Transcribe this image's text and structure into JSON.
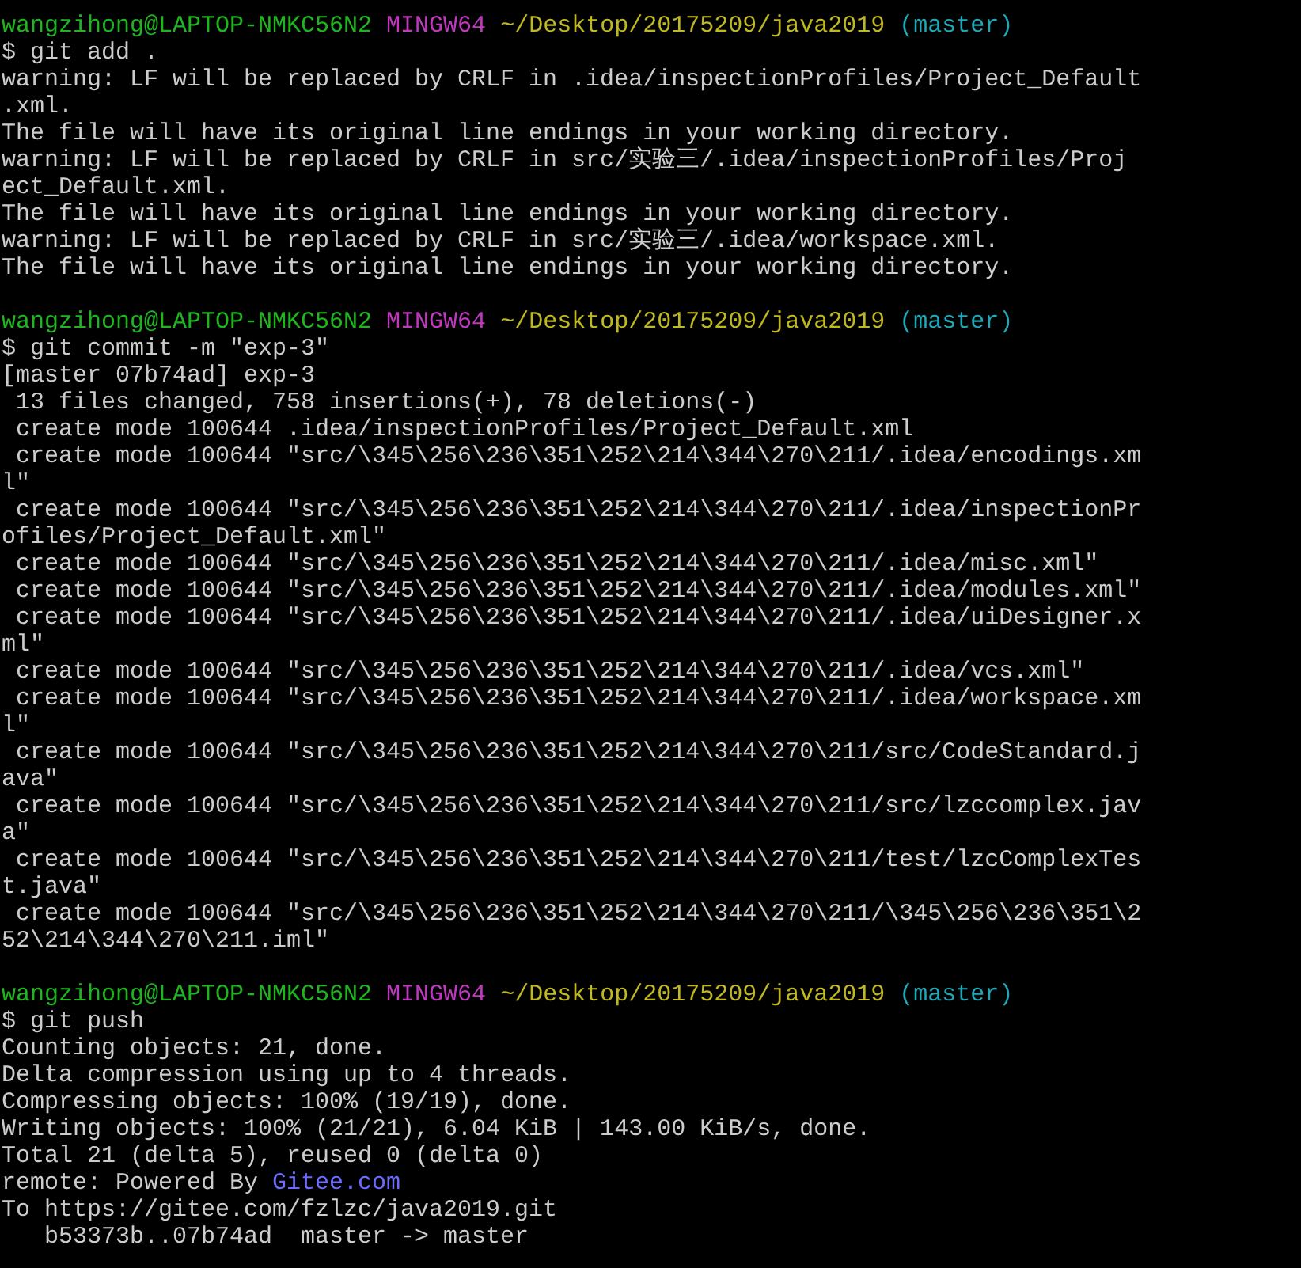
{
  "lines": [
    {
      "kind": "prompt",
      "user": "wangzihong@LAPTOP-NMKC56N2",
      "system": "MINGW64",
      "path": "~/Desktop/20175209/java2019",
      "branch": "(master)"
    },
    {
      "kind": "command",
      "text": "$ git add ."
    },
    {
      "kind": "output",
      "text": "warning: LF will be replaced by CRLF in .idea/inspectionProfiles/Project_Default"
    },
    {
      "kind": "output",
      "text": ".xml."
    },
    {
      "kind": "output",
      "text": "The file will have its original line endings in your working directory."
    },
    {
      "kind": "output",
      "text": "warning: LF will be replaced by CRLF in src/实验三/.idea/inspectionProfiles/Proj"
    },
    {
      "kind": "output",
      "text": "ect_Default.xml."
    },
    {
      "kind": "output",
      "text": "The file will have its original line endings in your working directory."
    },
    {
      "kind": "output",
      "text": "warning: LF will be replaced by CRLF in src/实验三/.idea/workspace.xml."
    },
    {
      "kind": "output",
      "text": "The file will have its original line endings in your working directory."
    },
    {
      "kind": "blank"
    },
    {
      "kind": "prompt",
      "user": "wangzihong@LAPTOP-NMKC56N2",
      "system": "MINGW64",
      "path": "~/Desktop/20175209/java2019",
      "branch": "(master)"
    },
    {
      "kind": "command",
      "text": "$ git commit -m \"exp-3\""
    },
    {
      "kind": "output",
      "text": "[master 07b74ad] exp-3"
    },
    {
      "kind": "output",
      "text": " 13 files changed, 758 insertions(+), 78 deletions(-)"
    },
    {
      "kind": "output",
      "text": " create mode 100644 .idea/inspectionProfiles/Project_Default.xml"
    },
    {
      "kind": "output",
      "text": " create mode 100644 \"src/\\345\\256\\236\\351\\252\\214\\344\\270\\211/.idea/encodings.xm"
    },
    {
      "kind": "output",
      "text": "l\""
    },
    {
      "kind": "output",
      "text": " create mode 100644 \"src/\\345\\256\\236\\351\\252\\214\\344\\270\\211/.idea/inspectionPr"
    },
    {
      "kind": "output",
      "text": "ofiles/Project_Default.xml\""
    },
    {
      "kind": "output",
      "text": " create mode 100644 \"src/\\345\\256\\236\\351\\252\\214\\344\\270\\211/.idea/misc.xml\""
    },
    {
      "kind": "output",
      "text": " create mode 100644 \"src/\\345\\256\\236\\351\\252\\214\\344\\270\\211/.idea/modules.xml\""
    },
    {
      "kind": "output",
      "text": " create mode 100644 \"src/\\345\\256\\236\\351\\252\\214\\344\\270\\211/.idea/uiDesigner.x"
    },
    {
      "kind": "output",
      "text": "ml\""
    },
    {
      "kind": "output",
      "text": " create mode 100644 \"src/\\345\\256\\236\\351\\252\\214\\344\\270\\211/.idea/vcs.xml\""
    },
    {
      "kind": "output",
      "text": " create mode 100644 \"src/\\345\\256\\236\\351\\252\\214\\344\\270\\211/.idea/workspace.xm"
    },
    {
      "kind": "output",
      "text": "l\""
    },
    {
      "kind": "output",
      "text": " create mode 100644 \"src/\\345\\256\\236\\351\\252\\214\\344\\270\\211/src/CodeStandard.j"
    },
    {
      "kind": "output",
      "text": "ava\""
    },
    {
      "kind": "output",
      "text": " create mode 100644 \"src/\\345\\256\\236\\351\\252\\214\\344\\270\\211/src/lzccomplex.jav"
    },
    {
      "kind": "output",
      "text": "a\""
    },
    {
      "kind": "output",
      "text": " create mode 100644 \"src/\\345\\256\\236\\351\\252\\214\\344\\270\\211/test/lzcComplexTes"
    },
    {
      "kind": "output",
      "text": "t.java\""
    },
    {
      "kind": "output",
      "text": " create mode 100644 \"src/\\345\\256\\236\\351\\252\\214\\344\\270\\211/\\345\\256\\236\\351\\2"
    },
    {
      "kind": "output",
      "text": "52\\214\\344\\270\\211.iml\""
    },
    {
      "kind": "blank"
    },
    {
      "kind": "prompt",
      "user": "wangzihong@LAPTOP-NMKC56N2",
      "system": "MINGW64",
      "path": "~/Desktop/20175209/java2019",
      "branch": "(master)"
    },
    {
      "kind": "command",
      "text": "$ git push"
    },
    {
      "kind": "output",
      "text": "Counting objects: 21, done."
    },
    {
      "kind": "output",
      "text": "Delta compression using up to 4 threads."
    },
    {
      "kind": "output",
      "text": "Compressing objects: 100% (19/19), done."
    },
    {
      "kind": "output",
      "text": "Writing objects: 100% (21/21), 6.04 KiB | 143.00 KiB/s, done."
    },
    {
      "kind": "output",
      "text": "Total 21 (delta 5), reused 0 (delta 0)"
    },
    {
      "kind": "remote",
      "text": "remote: Powered By",
      "link": "Gitee.com"
    },
    {
      "kind": "output",
      "text": "To https://gitee.com/fzlzc/java2019.git"
    },
    {
      "kind": "output",
      "text": "   b53373b..07b74ad  master -> master"
    }
  ]
}
